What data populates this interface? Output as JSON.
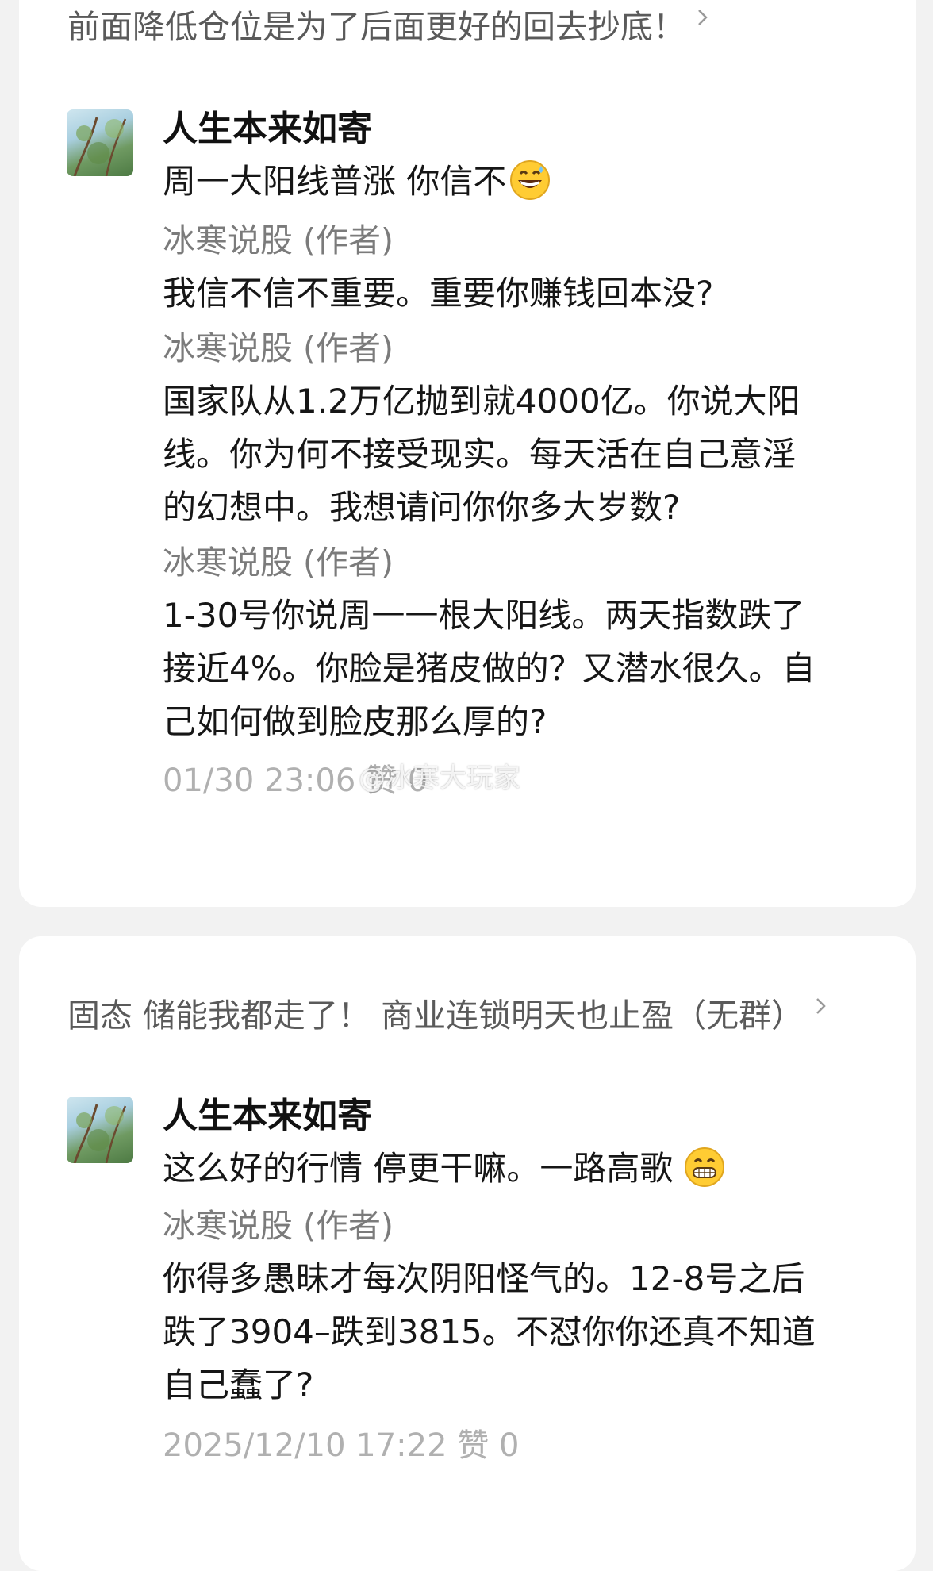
{
  "card1": {
    "post_title": "前面降低仓位是为了后面更好的回去抄底！",
    "comment": {
      "user": "人生本来如寄",
      "text": "周一大阳线普涨  你信不",
      "replies": [
        {
          "author": "冰寒说股 (作者)",
          "lines": [
            "我信不信不重要。重要你赚钱回本没?"
          ]
        },
        {
          "author": "冰寒说股 (作者)",
          "lines": [
            "国家队从1.2万亿抛到就4000亿。你说大阳",
            "线。你为何不接受现实。每天活在自己意淫",
            "的幻想中。我想请问你你多大岁数?"
          ]
        },
        {
          "author": "冰寒说股 (作者)",
          "lines": [
            "1-30号你说周一一根大阳线。两天指数跌了",
            "接近4%。你脸是猪皮做的？又潜水很久。自",
            "己如何做到脸皮那么厚的?"
          ]
        }
      ],
      "meta": "01/30 23:06 赞 0"
    }
  },
  "card2": {
    "post_title": "固态 储能我都走了！ 商业连锁明天也止盈（无群）",
    "comment": {
      "user": "人生本来如寄",
      "text": "这么好的行情 停更干嘛。一路高歌",
      "replies": [
        {
          "author": "冰寒说股 (作者)",
          "lines": [
            "你得多愚昧才每次阴阳怪气的。12-8号之后",
            "跌了3904–跌到3815。不怼你你还真不知道",
            "自己蠢了?"
          ]
        }
      ],
      "meta": "2025/12/10 17:22 赞 0"
    }
  },
  "watermark": "@冰寒大玩家",
  "icons": {
    "chevron": "chevron-right-icon",
    "emoji1": "grinning-sweat-emoji-icon",
    "emoji2": "grinning-teeth-emoji-icon"
  },
  "colors": {
    "background": "#f2f2f2",
    "card": "#ffffff",
    "meta": "#b0b0b0",
    "author": "#7b7b7b"
  }
}
